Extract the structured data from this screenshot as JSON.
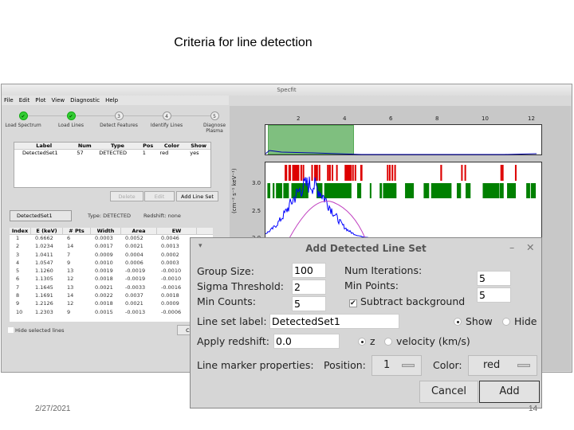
{
  "slide": {
    "title": "Criteria for line detection",
    "date": "2/27/2021",
    "page": "14"
  },
  "window": {
    "title": "Specfit",
    "menu": [
      "File",
      "Edit",
      "Plot",
      "View",
      "Diagnostic",
      "Help"
    ],
    "steps": [
      {
        "n": "✔",
        "label": "Load Spectrum",
        "done": true
      },
      {
        "n": "✔",
        "label": "Load Lines",
        "done": true
      },
      {
        "n": "3",
        "label": "Detect Features",
        "done": false
      },
      {
        "n": "4",
        "label": "Identify Lines",
        "done": false
      },
      {
        "n": "5",
        "label": "Diagnose Plasma",
        "done": false
      }
    ]
  },
  "line_sets": {
    "headers": [
      "Label",
      "Num",
      "Type",
      "Pos",
      "Color",
      "Show"
    ],
    "rows": [
      [
        "DetectedSet1",
        "57",
        "DETECTED",
        "1",
        "red",
        "yes"
      ]
    ],
    "delete": "Delete",
    "edit": "Edit",
    "add": "Add Line Set"
  },
  "detail": {
    "selected": "DetectedSet1",
    "type": "Type: DETECTED",
    "redshift": "Redshift: none",
    "headers": [
      "Index",
      "E (keV)",
      "# Pts",
      "Width",
      "Area",
      "EW"
    ],
    "rows": [
      [
        "1",
        "0.6662",
        "6",
        "0.0003",
        "0.0052",
        "0.0046"
      ],
      [
        "2",
        "1.0234",
        "14",
        "0.0017",
        "0.0021",
        "0.0013"
      ],
      [
        "3",
        "1.0411",
        "7",
        "0.0009",
        "0.0004",
        "0.0002"
      ],
      [
        "4",
        "1.0547",
        "9",
        "0.0010",
        "0.0006",
        "0.0003"
      ],
      [
        "5",
        "1.1260",
        "13",
        "0.0019",
        "-0.0019",
        "-0.0010"
      ],
      [
        "6",
        "1.1305",
        "12",
        "0.0018",
        "-0.0019",
        "-0.0010"
      ],
      [
        "7",
        "1.1645",
        "13",
        "0.0021",
        "-0.0033",
        "-0.0016"
      ],
      [
        "8",
        "1.1691",
        "14",
        "0.0022",
        "0.0037",
        "0.0018"
      ],
      [
        "9",
        "1.2126",
        "12",
        "0.0018",
        "0.0021",
        "0.0009"
      ],
      [
        "10",
        "1.2303",
        "9",
        "0.0015",
        "-0.0013",
        "-0.0006"
      ]
    ],
    "hide_label": "Hide selected lines",
    "close": "Close"
  },
  "plot": {
    "x_ticks": [
      "2",
      "4",
      "6",
      "8",
      "10",
      "12"
    ],
    "y_ticks": [
      "3.0",
      "2.5",
      "2.0"
    ],
    "ylabel": "(cm⁻² s⁻¹ keV⁻¹)",
    "colors": {
      "selection": "#7fbf7f",
      "detected": "#dd0000",
      "lines": "#008000",
      "spectrum": "#0000ff"
    }
  },
  "dialog": {
    "title": "Add Detected Line Set",
    "group_size_label": "Group Size:",
    "group_size": "100",
    "sigma_label": "Sigma Threshold:",
    "sigma": "2",
    "min_counts_label": "Min Counts:",
    "min_counts": "5",
    "num_iter_label": "Num Iterations:",
    "num_iter": "5",
    "min_points_label": "Min Points:",
    "min_points": "5",
    "subtract_label": "Subtract background",
    "set_label_label": "Line set label:",
    "set_label": "DetectedSet1",
    "show": "Show",
    "hide": "Hide",
    "redshift_label": "Apply redshift:",
    "redshift": "0.0",
    "z": "z",
    "velocity": "velocity (km/s)",
    "marker_label": "Line marker properties:",
    "position_label": "Position:",
    "position": "1",
    "color_label": "Color:",
    "color": "red",
    "cancel": "Cancel",
    "add": "Add"
  }
}
